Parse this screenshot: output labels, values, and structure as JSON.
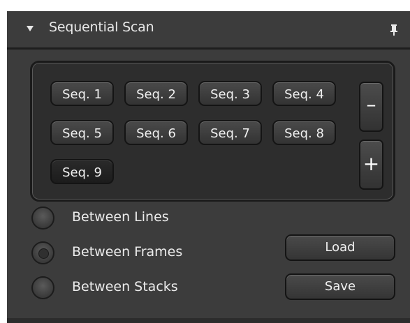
{
  "header": {
    "title": "Sequential Scan",
    "collapse_icon": "triangle-down-icon",
    "pin_icon": "pin-icon"
  },
  "sequences": {
    "items": [
      "Seq. 1",
      "Seq. 2",
      "Seq. 3",
      "Seq. 4",
      "Seq. 5",
      "Seq. 6",
      "Seq. 7",
      "Seq. 8",
      "Seq. 9"
    ],
    "selected": "Seq. 9",
    "remove_label": "–",
    "add_label": "+"
  },
  "scan_mode": {
    "options": [
      "Between Lines",
      "Between Frames",
      "Between Stacks"
    ],
    "selected": "Between Frames"
  },
  "actions": {
    "load_label": "Load",
    "save_label": "Save"
  },
  "colors": {
    "panel_bg": "#3c3c3c",
    "inner_bg": "#2d2d2d",
    "text": "#f0f0f0"
  }
}
